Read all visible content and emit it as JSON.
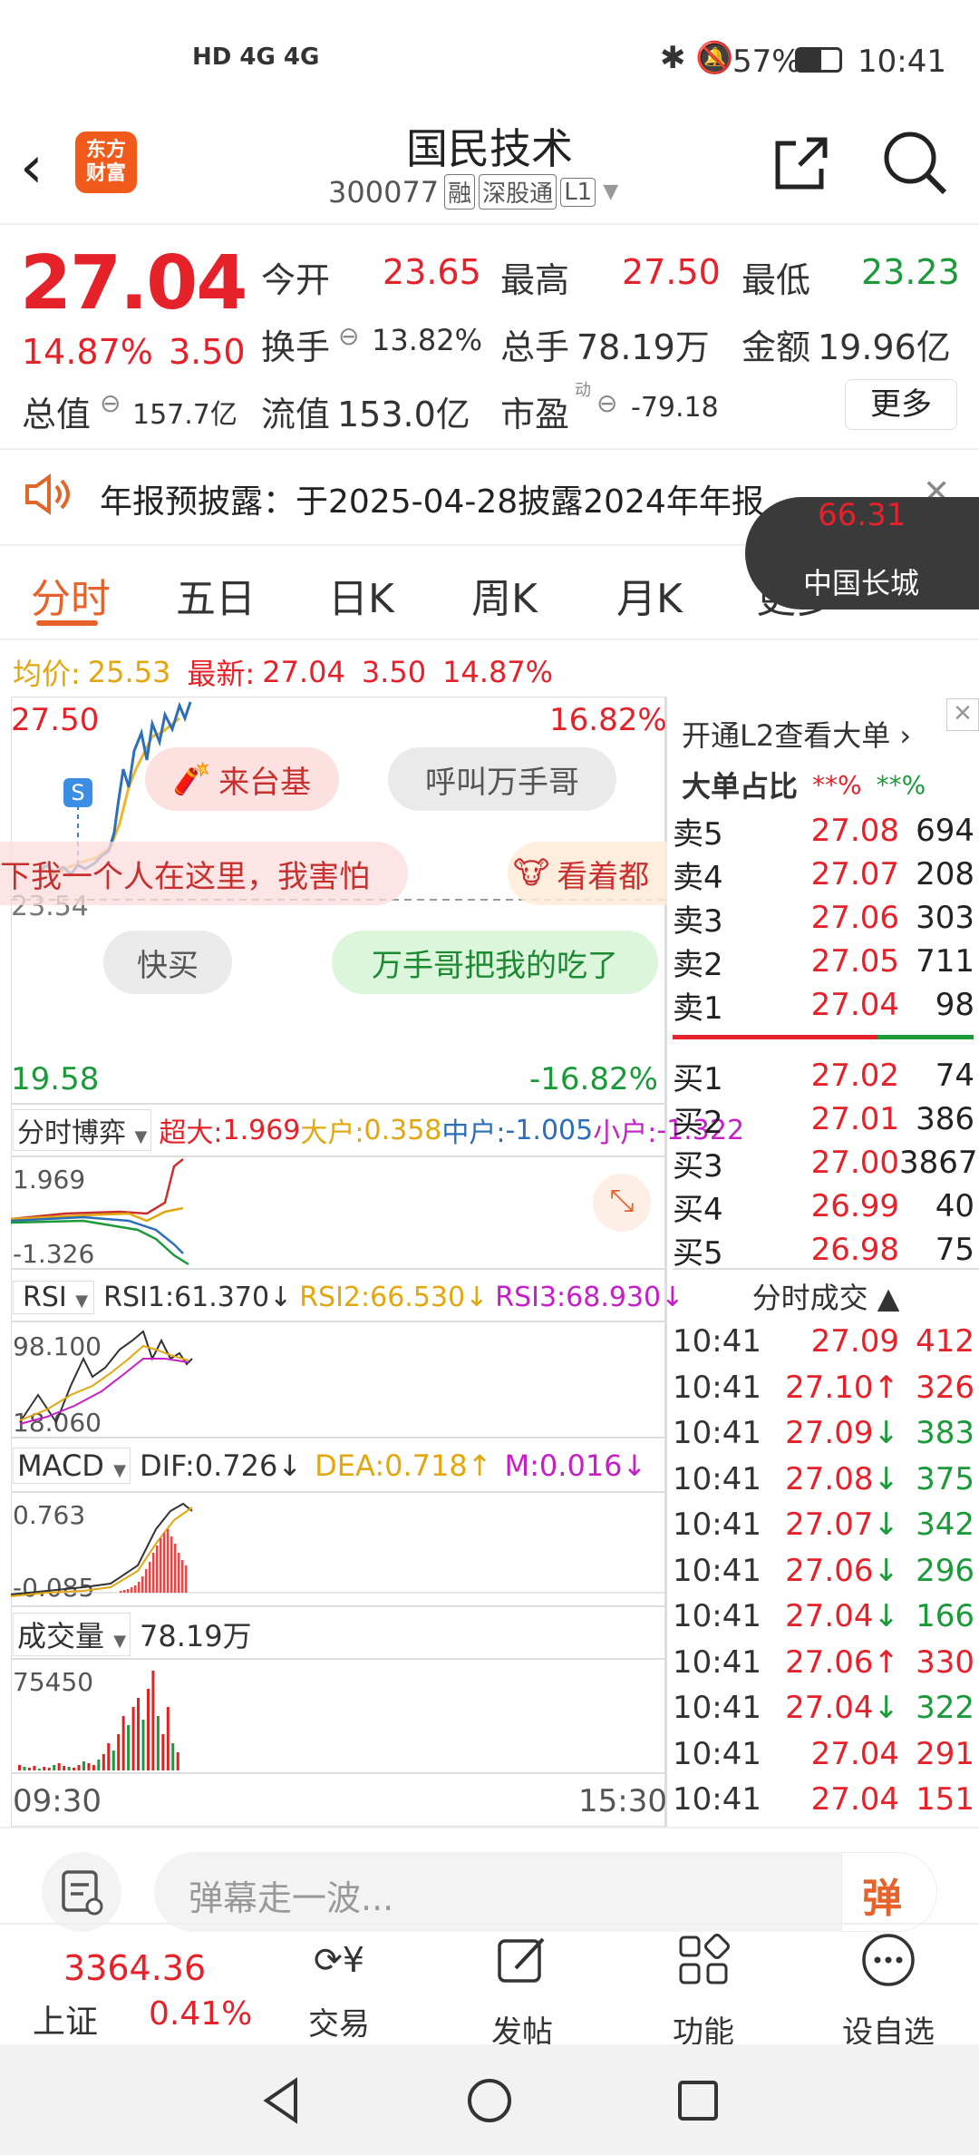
{
  "status": {
    "signal": "HD 4G 4G",
    "battery": "57%",
    "time": "10:41"
  },
  "header": {
    "logo": "东方\n财富",
    "name": "国民技术",
    "code": "300077",
    "tags": [
      "融",
      "深股通",
      "L1"
    ]
  },
  "quote": {
    "price": "27.04",
    "pct": "14.87%",
    "change": "3.50",
    "open_label": "今开",
    "open": "23.65",
    "high_label": "最高",
    "high": "27.50",
    "low_label": "最低",
    "low": "23.23",
    "turnover_label": "换手",
    "turnover": "13.82%",
    "vol_label": "总手",
    "vol": "78.19万",
    "amount_label": "金额",
    "amount": "19.96亿",
    "mcap_label": "总值",
    "mcap": "157.7亿",
    "float_label": "流值",
    "float": "153.0亿",
    "pe_label": "市盈",
    "pe_sup": "动",
    "pe": "-79.18",
    "more": "更多"
  },
  "notice": {
    "text": "年报预披露：于2025-04-28披露2024年年报"
  },
  "popup": {
    "value": "66.31",
    "name": "中国长城"
  },
  "tabs": [
    "分时",
    "五日",
    "日K",
    "周K",
    "月K",
    "更多"
  ],
  "intraday": {
    "avg_label": "均价:",
    "avg": "25.53",
    "last_label": "最新:",
    "last": "27.04",
    "chg": "3.50",
    "pct": "14.87%",
    "top": "27.50",
    "top_pct": "16.82%",
    "mid": "23.54",
    "bottom": "19.58",
    "bottom_pct": "-16.82%",
    "time_start": "09:30",
    "time_end": "15:30",
    "s_marker": "S"
  },
  "danmaku": [
    {
      "text": "来台基"
    },
    {
      "text": "呼叫万手哥"
    },
    {
      "text": "下我一个人在这里，我害怕"
    },
    {
      "text": "看着都"
    },
    {
      "text": "快买"
    },
    {
      "text": "万手哥把我的吃了"
    }
  ],
  "fund": {
    "label": "分时博弈",
    "big_label": "超大:",
    "big": "1.969",
    "large_label": "大户:",
    "large": "0.358",
    "mid_label": "中户:",
    "mid": "-1.005",
    "small_label": "小户:",
    "small": "-1.322",
    "max": "1.969",
    "min": "-1.326"
  },
  "rsi": {
    "label": "RSI",
    "r1": "RSI1:61.370↓",
    "r2": "RSI2:66.530↓",
    "r3": "RSI3:68.930↓",
    "max": "98.100",
    "min": "18.060"
  },
  "macd": {
    "label": "MACD",
    "dif": "DIF:0.726↓",
    "dea": "DEA:0.718↑",
    "m": "M:0.016↓",
    "max": "0.763",
    "min": "-0.085"
  },
  "volume": {
    "label": "成交量",
    "value": "78.19万",
    "max": "75450"
  },
  "l2": {
    "promo": "开通L2查看大单 ›",
    "ratio_label": "大单占比",
    "r1": "**%",
    "r2": "**%"
  },
  "orderbook": {
    "asks": [
      {
        "l": "卖5",
        "p": "27.08",
        "v": "694"
      },
      {
        "l": "卖4",
        "p": "27.07",
        "v": "208"
      },
      {
        "l": "卖3",
        "p": "27.06",
        "v": "303"
      },
      {
        "l": "卖2",
        "p": "27.05",
        "v": "711"
      },
      {
        "l": "卖1",
        "p": "27.04",
        "v": "98"
      }
    ],
    "bids": [
      {
        "l": "买1",
        "p": "27.02",
        "v": "74"
      },
      {
        "l": "买2",
        "p": "27.01",
        "v": "386"
      },
      {
        "l": "买3",
        "p": "27.00",
        "v": "3867"
      },
      {
        "l": "买4",
        "p": "26.99",
        "v": "40"
      },
      {
        "l": "买5",
        "p": "26.98",
        "v": "75"
      }
    ]
  },
  "trades": {
    "title": "分时成交 ▲",
    "rows": [
      {
        "t": "10:41",
        "p": "27.09",
        "a": "",
        "v": "412",
        "vc": "red"
      },
      {
        "t": "10:41",
        "p": "27.10",
        "a": "↑",
        "v": "326",
        "vc": "red"
      },
      {
        "t": "10:41",
        "p": "27.09",
        "a": "↓",
        "v": "383",
        "vc": "green"
      },
      {
        "t": "10:41",
        "p": "27.08",
        "a": "↓",
        "v": "375",
        "vc": "green"
      },
      {
        "t": "10:41",
        "p": "27.07",
        "a": "↓",
        "v": "342",
        "vc": "green"
      },
      {
        "t": "10:41",
        "p": "27.06",
        "a": "↓",
        "v": "296",
        "vc": "green"
      },
      {
        "t": "10:41",
        "p": "27.04",
        "a": "↓",
        "v": "166",
        "vc": "green"
      },
      {
        "t": "10:41",
        "p": "27.06",
        "a": "↑",
        "v": "330",
        "vc": "red"
      },
      {
        "t": "10:41",
        "p": "27.04",
        "a": "↓",
        "v": "322",
        "vc": "green"
      },
      {
        "t": "10:41",
        "p": "27.04",
        "a": "",
        "v": "291",
        "vc": "red"
      },
      {
        "t": "10:41",
        "p": "27.04",
        "a": "",
        "v": "151",
        "vc": "red"
      }
    ]
  },
  "comment": {
    "placeholder": "弹幕走一波...",
    "danmaku_btn": "弹"
  },
  "bottom": {
    "index_value": "3364.36",
    "index_name": "上证",
    "index_pct": "0.41%",
    "items": [
      "交易",
      "发帖",
      "功能",
      "设自选"
    ]
  }
}
